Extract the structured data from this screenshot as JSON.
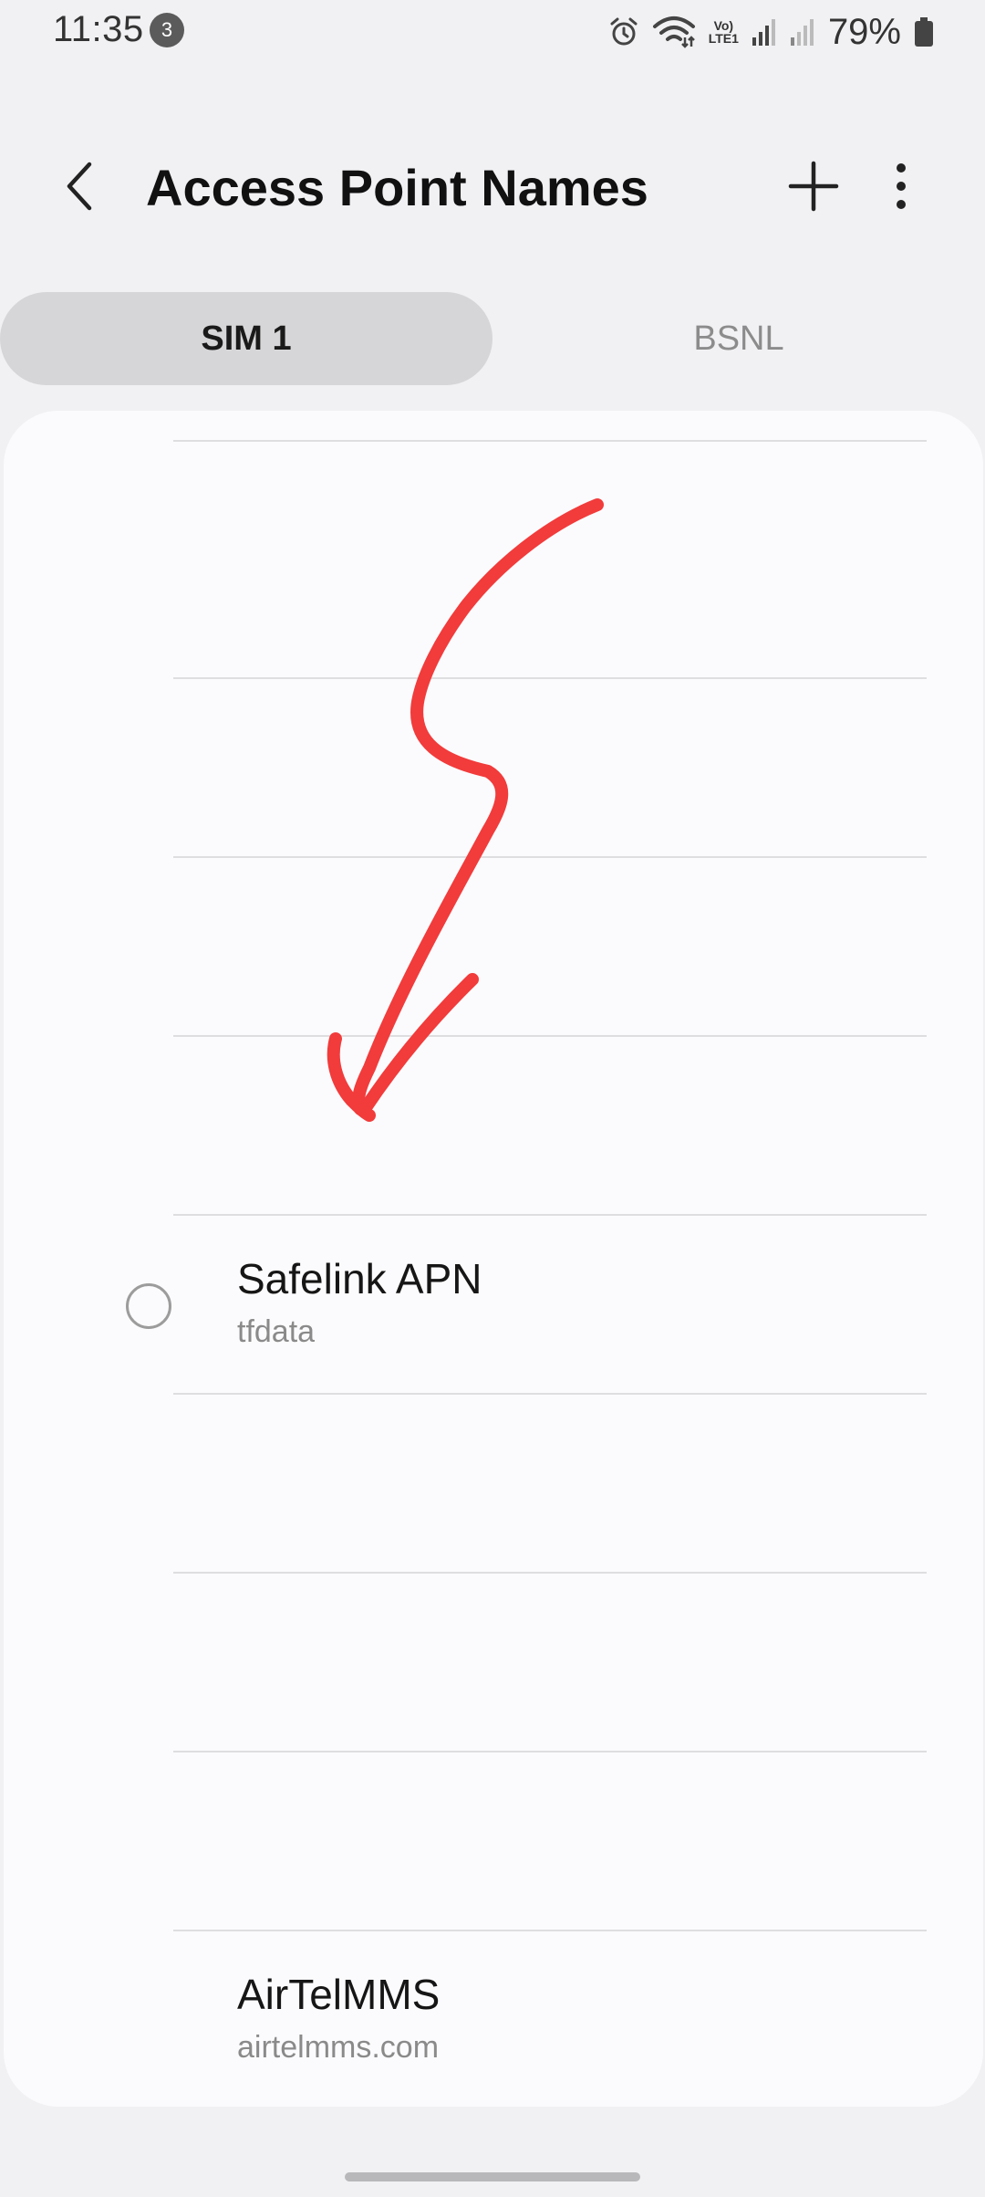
{
  "status_bar": {
    "time": "11:35",
    "notification_count": "3",
    "battery": "79%",
    "volte_top": "Vo)",
    "volte_bottom": "LTE1",
    "icons": [
      "alarm-icon",
      "wifi-icon",
      "volte-icon",
      "signal-sim1-icon",
      "signal-sim2-icon",
      "battery-icon"
    ]
  },
  "app_bar": {
    "title": "Access Point Names",
    "back_icon": "chevron-left-icon",
    "add_icon": "plus-icon",
    "more_icon": "more-vertical-icon"
  },
  "tabs": [
    {
      "label": "SIM 1",
      "selected": true
    },
    {
      "label": "BSNL",
      "selected": false
    }
  ],
  "apn_list": {
    "items": [
      {
        "name": "Safelink APN",
        "apn": "tfdata",
        "has_radio": true,
        "selected": false
      },
      {
        "name": "AirTelMMS",
        "apn": "airtelmms.com",
        "has_radio": false,
        "selected": false
      }
    ]
  },
  "annotation": {
    "type": "hand-drawn-arrow",
    "color": "#f23b3b"
  },
  "colors": {
    "background": "#f1f1f3",
    "card": "#fbfbfd",
    "selected_tab": "#d6d6d8",
    "annotation_red": "#f23b3b"
  }
}
